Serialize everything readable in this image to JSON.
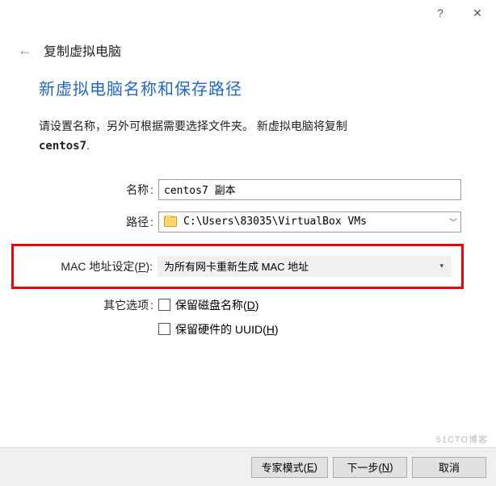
{
  "titlebar": {
    "help": "?",
    "close": "✕"
  },
  "header": {
    "back": "←",
    "title": "复制虚拟电脑"
  },
  "section_title": "新虚拟电脑名称和保存路径",
  "description_line1": "请设置名称，另外可根据需要选择文件夹。 新虚拟电脑将复制",
  "description_bold": "centos7",
  "description_dot": ".",
  "form": {
    "name_label": "名称",
    "name_value": "centos7 副本",
    "path_label": "路径",
    "path_value": "C:\\Users\\83035\\VirtualBox VMs",
    "mac_label_pre": "MAC 地址设定(",
    "mac_label_u": "P",
    "mac_label_post": ")",
    "mac_value": "为所有网卡重新生成 MAC 地址",
    "other_label": "其它选项",
    "cb1_pre": "保留磁盘名称(",
    "cb1_u": "D",
    "cb1_post": ")",
    "cb2_pre": "保留硬件的 UUID(",
    "cb2_u": "H",
    "cb2_post": ")"
  },
  "buttons": {
    "expert_pre": "专家模式(",
    "expert_u": "E",
    "expert_post": ")",
    "next_pre": "下一步(",
    "next_u": "N",
    "next_post": ")",
    "cancel": "取消"
  },
  "watermark": "51CTO博客"
}
